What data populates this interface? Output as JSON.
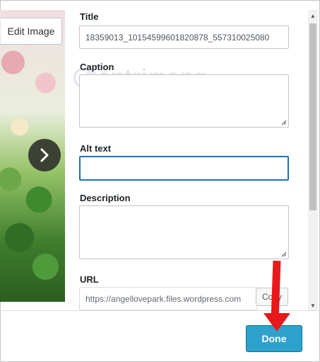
{
  "preview": {
    "edit_image_label": "Edit Image"
  },
  "fields": {
    "title_label": "Title",
    "title_value": "18359013_10154599601820878_557310025080",
    "caption_label": "Caption",
    "caption_value": "",
    "alt_label": "Alt text",
    "alt_value": "",
    "description_label": "Description",
    "description_value": "",
    "url_label": "URL",
    "url_value": "https://angellovepark.files.wordpress.com",
    "copy_label": "Copy"
  },
  "footer": {
    "done_label": "Done"
  },
  "watermark": "uantrimang",
  "colors": {
    "accent": "#2ea2cc",
    "focus": "#2271b1",
    "annotation": "#e8191b"
  },
  "icons": [
    "chevron-right-icon",
    "scroll-up-icon",
    "scroll-down-icon",
    "resize-handle-icon",
    "red-arrow-annotation"
  ]
}
